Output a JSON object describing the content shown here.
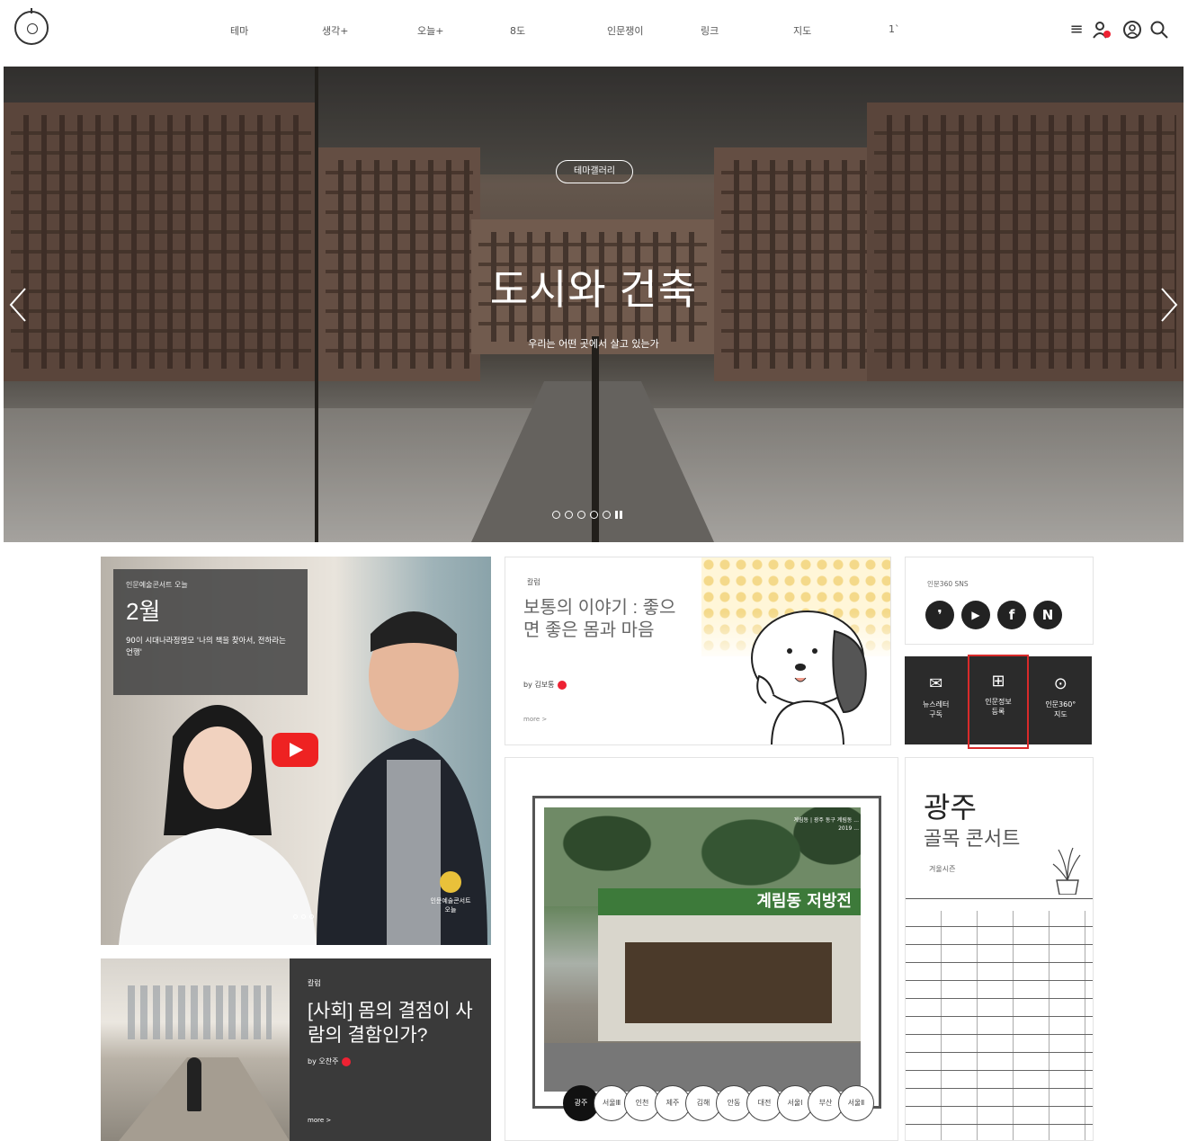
{
  "header": {
    "nav": [
      "테마",
      "생각+",
      "오늘+",
      "8도",
      "인문쟁이",
      "링크",
      "지도",
      "1`"
    ],
    "icons": [
      "menu-icon",
      "user-icon",
      "account-icon",
      "search-icon"
    ]
  },
  "hero": {
    "tag": "테마갤러리",
    "title": "도시와 건축",
    "subtitle": "우리는 어떤 곳에서 살고 있는가",
    "slide_count": 6
  },
  "video_card": {
    "label": "인문예술콘서트 오늘",
    "month": "2월",
    "desc": "90이 시대나라정명모 '나의 책을 찾아서, 전하라는 언행'",
    "badge_line1": "인문예술콘서트",
    "badge_line2": "오늘"
  },
  "article_card": {
    "category": "칼럼",
    "title": "보통의 이야기 : 좋으면 좋은 몸과 마음",
    "byline": "by 김보통",
    "more": "more >"
  },
  "sns": {
    "label": "인문360 SNS",
    "icons": [
      {
        "name": "kakao-story-icon",
        "glyph": "❜"
      },
      {
        "name": "youtube-icon",
        "glyph": "▶"
      },
      {
        "name": "facebook-icon",
        "glyph": "f"
      },
      {
        "name": "naver-icon",
        "glyph": "N"
      }
    ]
  },
  "tiles": [
    {
      "line1": "뉴스레터",
      "line2": "구독",
      "icon": "✉"
    },
    {
      "line1": "인문정보",
      "line2": "등록",
      "icon": "⊞"
    },
    {
      "line1": "인문360°",
      "line2": "지도",
      "icon": "⊙"
    }
  ],
  "map_card": {
    "sign": "계림동 저방전",
    "poster_line1": "계림동 | 광주 동구 계림동 ...",
    "poster_line2": "2019 ...",
    "cities": [
      "광주",
      "서울Ⅲ",
      "인천",
      "제주",
      "김해",
      "안동",
      "대전",
      "서울Ⅰ",
      "부산",
      "서울Ⅱ"
    ],
    "active_city": "광주"
  },
  "gwangju": {
    "title": "광주",
    "subtitle": "골목 콘서트",
    "season": "겨울시즌"
  },
  "bottom_card": {
    "category": "칼럼",
    "title": "[사회] 몸의 결점이 사람의 결함인가?",
    "byline": "by 오찬주",
    "more": "more >"
  }
}
